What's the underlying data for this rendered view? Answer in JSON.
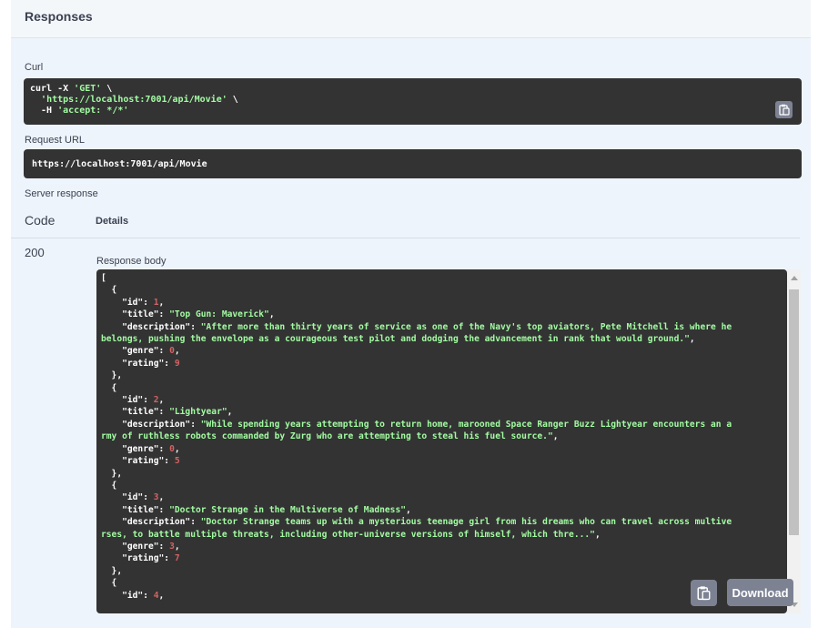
{
  "section_title": "Responses",
  "curl": {
    "label": "Curl",
    "line1": "curl -X ",
    "method": "'GET'",
    "line1_end": " \\",
    "url": "'https://localhost:7001/api/Movie'",
    "url_end": " \\",
    "header_flag": "  -H ",
    "header": "'accept: */*'"
  },
  "request_url": {
    "label": "Request URL",
    "value": "https://localhost:7001/api/Movie"
  },
  "server_response": {
    "label": "Server response",
    "code_header": "Code",
    "details_header": "Details",
    "code": "200",
    "body_label": "Response body"
  },
  "movies": [
    {
      "id": "1",
      "title": "\"Top Gun: Maverick\"",
      "description_1": "\"After more than thirty years of service as one of the Navy's top aviators, Pete Mitchell is where he",
      "description_2": "belongs, pushing the envelope as a courageous test pilot and dodging the advancement in rank that would ground.\"",
      "genre": "0",
      "rating": "9"
    },
    {
      "id": "2",
      "title": "\"Lightyear\"",
      "description_1": "\"While spending years attempting to return home, marooned Space Ranger Buzz Lightyear encounters an a",
      "description_2": "rmy of ruthless robots commanded by Zurg who are attempting to steal his fuel source.\"",
      "genre": "0",
      "rating": "5"
    },
    {
      "id": "3",
      "title": "\"Doctor Strange in the Multiverse of Madness\"",
      "description_1": "\"Doctor Strange teams up with a mysterious teenage girl from his dreams who can travel across multive",
      "description_2": "rses, to battle multiple threats, including other-universe versions of himself, which thre...\"",
      "genre": "3",
      "rating": "7"
    },
    {
      "id": "4"
    }
  ],
  "json_syntax": {
    "open_bracket": "[",
    "open_brace": "  {",
    "close_brace": "  },",
    "id_key": "    \"id\": ",
    "title_key": "    \"title\": ",
    "description_key": "    \"description\": ",
    "genre_key": "    \"genre\": ",
    "rating_key": "    \"rating\": ",
    "comma": ","
  },
  "buttons": {
    "download": "Download"
  },
  "icons": {
    "copy": "clipboard-icon",
    "scroll_up": "scroll-up-arrow-icon",
    "scroll_down": "scroll-down-arrow-icon"
  },
  "colors": {
    "code_bg": "#333333",
    "string": "#a2fca2",
    "number": "#d36363",
    "button": "#7d8293"
  }
}
